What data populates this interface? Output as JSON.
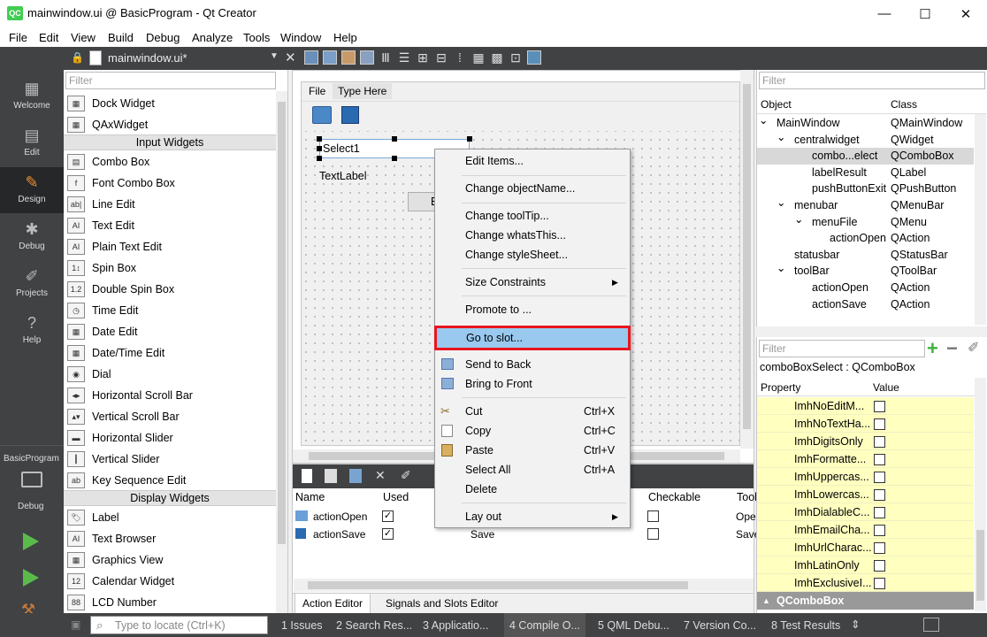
{
  "window": {
    "title": "mainwindow.ui @ BasicProgram - Qt Creator",
    "logo": "QC",
    "minimize": "—",
    "maximize": "☐",
    "close": "✕"
  },
  "menu": [
    "File",
    "Edit",
    "View",
    "Build",
    "Debug",
    "Analyze",
    "Tools",
    "Window",
    "Help"
  ],
  "editor_tab": {
    "file": "mainwindow.ui*"
  },
  "modes": [
    {
      "label": "Welcome",
      "icon": "grid-icon"
    },
    {
      "label": "Edit",
      "icon": "document-icon"
    },
    {
      "label": "Design",
      "icon": "pencil-icon"
    },
    {
      "label": "Debug",
      "icon": "bug-icon"
    },
    {
      "label": "Projects",
      "icon": "wrench-icon"
    },
    {
      "label": "Help",
      "icon": "question-icon"
    }
  ],
  "kit": {
    "project": "BasicProgram",
    "config": "Debug"
  },
  "widget_box": {
    "filter_placeholder": "Filter",
    "items_top": [
      "Dock Widget",
      "QAxWidget"
    ],
    "cat_input": "Input Widgets",
    "input": [
      "Combo Box",
      "Font Combo Box",
      "Line Edit",
      "Text Edit",
      "Plain Text Edit",
      "Spin Box",
      "Double Spin Box",
      "Time Edit",
      "Date Edit",
      "Date/Time Edit",
      "Dial",
      "Horizontal Scroll Bar",
      "Vertical Scroll Bar",
      "Horizontal Slider",
      "Vertical Slider",
      "Key Sequence Edit"
    ],
    "cat_display": "Display Widgets",
    "display": [
      "Label",
      "Text Browser",
      "Graphics View",
      "Calendar Widget",
      "LCD Number"
    ],
    "icon_glyphs": [
      "▦",
      "▦",
      "▤",
      "f",
      "ab|",
      "AI",
      "AI",
      "1↕",
      "1.2",
      "◷",
      "▦",
      "▦",
      "◉",
      "◂▸",
      "▴▾",
      "▬",
      "┃",
      "ab",
      "🏷",
      "AI",
      "▦",
      "12",
      "88"
    ]
  },
  "form": {
    "menu_file": "File",
    "menu_type_here": "Type Here",
    "combo_text": "Select1",
    "label_text": "TextLabel",
    "button_text": "E"
  },
  "context_menu": {
    "items": [
      "Edit Items...",
      "Change objectName...",
      "Change toolTip...",
      "Change whatsThis...",
      "Change styleSheet...",
      "Size Constraints",
      "Promote to ...",
      "Go to slot...",
      "Send to Back",
      "Bring to Front",
      "Cut",
      "Copy",
      "Paste",
      "Select All",
      "Delete",
      "Lay out"
    ],
    "shortcuts": {
      "cut": "Ctrl+X",
      "copy": "Ctrl+C",
      "paste": "Ctrl+V",
      "select_all": "Ctrl+A"
    }
  },
  "action_editor": {
    "headers": [
      "Name",
      "Used",
      "Checkable",
      "Tool"
    ],
    "rows": [
      {
        "name": "actionOpen",
        "used": true,
        "text": "",
        "checkable": false,
        "tooltip": "Ope"
      },
      {
        "name": "actionSave",
        "used": true,
        "text": "Save",
        "checkable": false,
        "tooltip": "Save"
      }
    ],
    "tabs": [
      "Action Editor",
      "Signals and Slots Editor"
    ]
  },
  "object_inspector": {
    "filter_placeholder": "Filter",
    "headers": [
      "Object",
      "Class"
    ],
    "rows": [
      [
        "MainWindow",
        "QMainWindow"
      ],
      [
        "centralwidget",
        "QWidget"
      ],
      [
        "combo...elect",
        "QComboBox"
      ],
      [
        "labelResult",
        "QLabel"
      ],
      [
        "pushButtonExit",
        "QPushButton"
      ],
      [
        "menubar",
        "QMenuBar"
      ],
      [
        "menuFile",
        "QMenu"
      ],
      [
        "actionOpen",
        "QAction"
      ],
      [
        "statusbar",
        "QStatusBar"
      ],
      [
        "toolBar",
        "QToolBar"
      ],
      [
        "actionOpen",
        "QAction"
      ],
      [
        "actionSave",
        "QAction"
      ]
    ]
  },
  "property_editor": {
    "filter_placeholder": "Filter",
    "selected": "comboBoxSelect : QComboBox",
    "headers": [
      "Property",
      "Value"
    ],
    "rows": [
      "ImhNoEditM...",
      "ImhNoTextHa...",
      "ImhDigitsOnly",
      "ImhFormatte...",
      "ImhUppercas...",
      "ImhLowercas...",
      "ImhDialableC...",
      "ImhEmailCha...",
      "ImhUrlCharac...",
      "ImhLatinOnly",
      "ImhExclusiveI..."
    ],
    "section": "QComboBox"
  },
  "status": {
    "locate_placeholder": "Type to locate (Ctrl+K)",
    "panes": [
      "1  Issues",
      "2  Search Res...",
      "3  Applicatio...",
      "4  Compile O...",
      "5  QML Debu...",
      "7  Version Co...",
      "8  Test Results"
    ]
  },
  "colors": {
    "highlight": "#99c9ef",
    "red_box": "#e8151f",
    "prop_yellow": "#ffffc0",
    "dark": "#404244",
    "green_plus": "#3cb43c"
  }
}
